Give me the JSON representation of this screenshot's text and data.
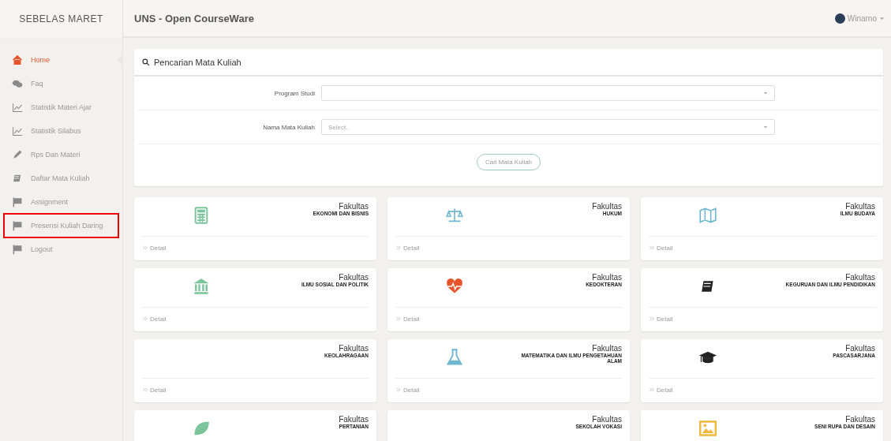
{
  "sidebar": {
    "brand": "SEBELAS MARET",
    "items": [
      {
        "label": "Home",
        "kind": "home",
        "selected": true,
        "highlighted": false
      },
      {
        "label": "Faq",
        "kind": "chat",
        "selected": false,
        "highlighted": false
      },
      {
        "label": "Statistik Materi Ajar",
        "kind": "chart",
        "selected": false,
        "highlighted": false
      },
      {
        "label": "Statistik Silabus",
        "kind": "chart",
        "selected": false,
        "highlighted": false
      },
      {
        "label": "Rps Dan Materi",
        "kind": "pencil",
        "selected": false,
        "highlighted": false
      },
      {
        "label": "Daftar Mata Kuliah",
        "kind": "book",
        "selected": false,
        "highlighted": false
      },
      {
        "label": "Assignment",
        "kind": "flag",
        "selected": false,
        "highlighted": false
      },
      {
        "label": "Presensi Kuliah Daring",
        "kind": "flag",
        "selected": false,
        "highlighted": true
      },
      {
        "label": "Logout",
        "kind": "flag",
        "selected": false,
        "highlighted": false
      }
    ]
  },
  "header": {
    "title": "UNS - Open CourseWare",
    "user": "Winarno"
  },
  "search_panel": {
    "title": "Pencarian Mata Kuliah",
    "fields": [
      {
        "label": "Program Studi"
      },
      {
        "label": "Nama Mata Kuliah",
        "placeholder": "Select.."
      }
    ],
    "button": "Cari Mata Kuliah"
  },
  "faculties": [
    {
      "title": "Fakultas",
      "name": "EKONOMI DAN BISNIS",
      "kind": "calculator",
      "detail": "Detail"
    },
    {
      "title": "Fakultas",
      "name": "HUKUM",
      "kind": "scales",
      "detail": "Detail"
    },
    {
      "title": "Fakultas",
      "name": "ILMU BUDAYA",
      "kind": "map",
      "detail": "Detail"
    },
    {
      "title": "Fakultas",
      "name": "ILMU SOSIAL DAN POLITIK",
      "kind": "bank",
      "detail": "Detail"
    },
    {
      "title": "Fakultas",
      "name": "KEDOKTERAN",
      "kind": "heart",
      "detail": "Detail"
    },
    {
      "title": "Fakultas",
      "name": "KEGURUAN DAN ILMU PENDIDIKAN",
      "kind": "book",
      "detail": "Detail"
    },
    {
      "title": "Fakultas",
      "name": "KEOLAHRAGAAN",
      "kind": "plain",
      "detail": "Detail"
    },
    {
      "title": "Fakultas",
      "name": "MATEMATIKA DAN ILMU PENGETAHUAN ALAM",
      "kind": "flask",
      "detail": "Detail"
    },
    {
      "title": "Fakultas",
      "name": "PASCASARJANA",
      "kind": "cap",
      "detail": "Detail"
    },
    {
      "title": "Fakultas",
      "name": "PERTANIAN",
      "kind": "leaf"
    },
    {
      "title": "Fakultas",
      "name": "SEKOLAH VOKASI",
      "kind": "plain"
    },
    {
      "title": "Fakultas",
      "name": "SENI RUPA DAN DESAIN",
      "kind": "image"
    }
  ]
}
